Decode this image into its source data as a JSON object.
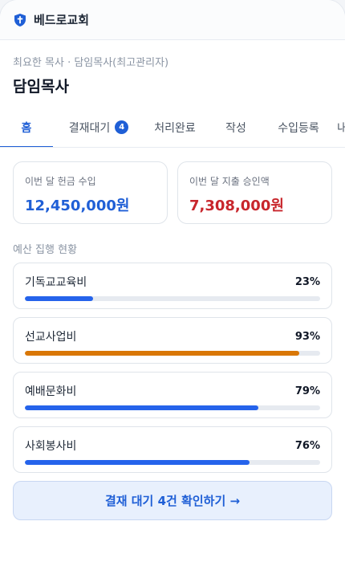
{
  "app": {
    "name": "베드로교회",
    "icon": "church-cross-shield-icon"
  },
  "header": {
    "role": "최요한 목사 · 담임목사(최고관리자)",
    "title": "담임목사"
  },
  "tabs": [
    {
      "label": "홈",
      "active": true
    },
    {
      "label": "결재대기",
      "badge": "4"
    },
    {
      "label": "처리완료"
    },
    {
      "label": "작성"
    },
    {
      "label": "수입등록"
    },
    {
      "label": "내"
    }
  ],
  "stats": {
    "income": {
      "label": "이번 달 헌금 수입",
      "value": "12,450,000원"
    },
    "expense": {
      "label": "이번 달 지출 승인액",
      "value": "7,308,000원"
    }
  },
  "budget": {
    "title": "예산 집행 현황",
    "items": [
      {
        "name": "기독교교육비",
        "percent": "23%",
        "fill": 0.23,
        "color": "#2563eb"
      },
      {
        "name": "선교사업비",
        "percent": "93%",
        "fill": 0.93,
        "color": "#d97706"
      },
      {
        "name": "예배문화비",
        "percent": "79%",
        "fill": 0.79,
        "color": "#2563eb"
      },
      {
        "name": "사회봉사비",
        "percent": "76%",
        "fill": 0.76,
        "color": "#2563eb"
      }
    ]
  },
  "cta": {
    "label": "결재 대기 4건 확인하기 →"
  }
}
